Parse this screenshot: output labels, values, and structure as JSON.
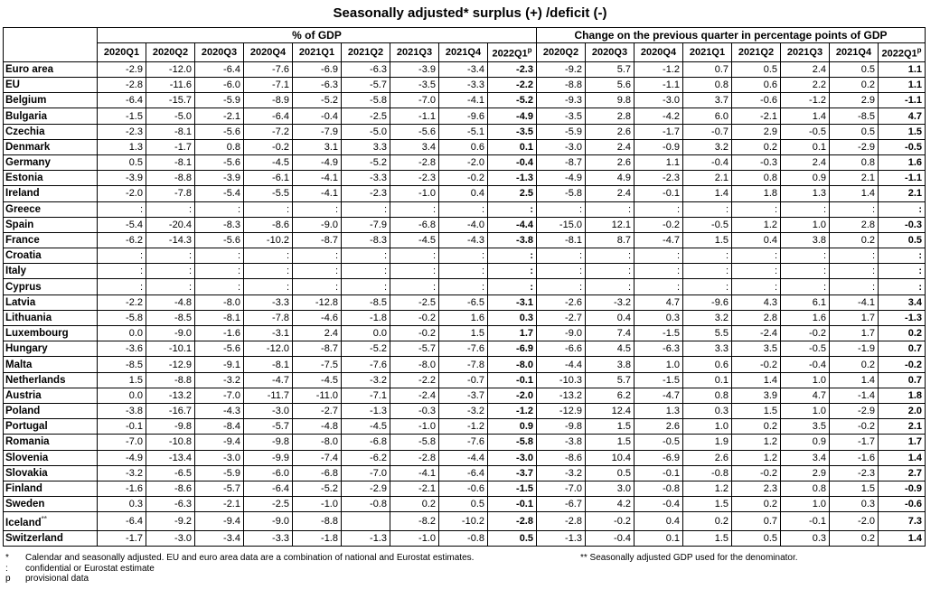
{
  "title": "Seasonally adjusted* surplus (+) /deficit (-)",
  "groups": {
    "left": "% of GDP",
    "right": "Change on the previous quarter in percentage points of GDP"
  },
  "headers_left": [
    "2020Q1",
    "2020Q2",
    "2020Q3",
    "2020Q4",
    "2021Q1",
    "2021Q2",
    "2021Q3",
    "2021Q4",
    "2022Q1"
  ],
  "headers_right": [
    "2020Q2",
    "2020Q3",
    "2020Q4",
    "2021Q1",
    "2021Q2",
    "2021Q3",
    "2021Q4",
    "2022Q1"
  ],
  "provisional_mark": "p",
  "rows": [
    {
      "country": "Euro area",
      "pct": [
        "-2.9",
        "-12.0",
        "-6.4",
        "-7.6",
        "-6.9",
        "-6.3",
        "-3.9",
        "-3.4",
        "-2.3"
      ],
      "chg": [
        "-9.2",
        "5.7",
        "-1.2",
        "0.7",
        "0.5",
        "2.4",
        "0.5",
        "1.1"
      ]
    },
    {
      "country": "EU",
      "pct": [
        "-2.8",
        "-11.6",
        "-6.0",
        "-7.1",
        "-6.3",
        "-5.7",
        "-3.5",
        "-3.3",
        "-2.2"
      ],
      "chg": [
        "-8.8",
        "5.6",
        "-1.1",
        "0.8",
        "0.6",
        "2.2",
        "0.2",
        "1.1"
      ]
    },
    {
      "country": "Belgium",
      "pct": [
        "-6.4",
        "-15.7",
        "-5.9",
        "-8.9",
        "-5.2",
        "-5.8",
        "-7.0",
        "-4.1",
        "-5.2"
      ],
      "chg": [
        "-9.3",
        "9.8",
        "-3.0",
        "3.7",
        "-0.6",
        "-1.2",
        "2.9",
        "-1.1"
      ]
    },
    {
      "country": "Bulgaria",
      "pct": [
        "-1.5",
        "-5.0",
        "-2.1",
        "-6.4",
        "-0.4",
        "-2.5",
        "-1.1",
        "-9.6",
        "-4.9"
      ],
      "chg": [
        "-3.5",
        "2.8",
        "-4.2",
        "6.0",
        "-2.1",
        "1.4",
        "-8.5",
        "4.7"
      ]
    },
    {
      "country": "Czechia",
      "pct": [
        "-2.3",
        "-8.1",
        "-5.6",
        "-7.2",
        "-7.9",
        "-5.0",
        "-5.6",
        "-5.1",
        "-3.5"
      ],
      "chg": [
        "-5.9",
        "2.6",
        "-1.7",
        "-0.7",
        "2.9",
        "-0.5",
        "0.5",
        "1.5"
      ]
    },
    {
      "country": "Denmark",
      "pct": [
        "1.3",
        "-1.7",
        "0.8",
        "-0.2",
        "3.1",
        "3.3",
        "3.4",
        "0.6",
        "0.1"
      ],
      "chg": [
        "-3.0",
        "2.4",
        "-0.9",
        "3.2",
        "0.2",
        "0.1",
        "-2.9",
        "-0.5"
      ]
    },
    {
      "country": "Germany",
      "pct": [
        "0.5",
        "-8.1",
        "-5.6",
        "-4.5",
        "-4.9",
        "-5.2",
        "-2.8",
        "-2.0",
        "-0.4"
      ],
      "chg": [
        "-8.7",
        "2.6",
        "1.1",
        "-0.4",
        "-0.3",
        "2.4",
        "0.8",
        "1.6"
      ]
    },
    {
      "country": "Estonia",
      "pct": [
        "-3.9",
        "-8.8",
        "-3.9",
        "-6.1",
        "-4.1",
        "-3.3",
        "-2.3",
        "-0.2",
        "-1.3"
      ],
      "chg": [
        "-4.9",
        "4.9",
        "-2.3",
        "2.1",
        "0.8",
        "0.9",
        "2.1",
        "-1.1"
      ]
    },
    {
      "country": "Ireland",
      "pct": [
        "-2.0",
        "-7.8",
        "-5.4",
        "-5.5",
        "-4.1",
        "-2.3",
        "-1.0",
        "0.4",
        "2.5"
      ],
      "chg": [
        "-5.8",
        "2.4",
        "-0.1",
        "1.4",
        "1.8",
        "1.3",
        "1.4",
        "2.1"
      ]
    },
    {
      "country": "Greece",
      "pct": [
        ":",
        ":",
        ":",
        ":",
        ":",
        ":",
        ":",
        ":",
        ":"
      ],
      "chg": [
        ":",
        ":",
        ":",
        ":",
        ":",
        ":",
        ":",
        ":"
      ]
    },
    {
      "country": "Spain",
      "pct": [
        "-5.4",
        "-20.4",
        "-8.3",
        "-8.6",
        "-9.0",
        "-7.9",
        "-6.8",
        "-4.0",
        "-4.4"
      ],
      "chg": [
        "-15.0",
        "12.1",
        "-0.2",
        "-0.5",
        "1.2",
        "1.0",
        "2.8",
        "-0.3"
      ]
    },
    {
      "country": "France",
      "pct": [
        "-6.2",
        "-14.3",
        "-5.6",
        "-10.2",
        "-8.7",
        "-8.3",
        "-4.5",
        "-4.3",
        "-3.8"
      ],
      "chg": [
        "-8.1",
        "8.7",
        "-4.7",
        "1.5",
        "0.4",
        "3.8",
        "0.2",
        "0.5"
      ]
    },
    {
      "country": "Croatia",
      "pct": [
        ":",
        ":",
        ":",
        ":",
        ":",
        ":",
        ":",
        ":",
        ":"
      ],
      "chg": [
        ":",
        ":",
        ":",
        ":",
        ":",
        ":",
        ":",
        ":"
      ]
    },
    {
      "country": "Italy",
      "pct": [
        ":",
        ":",
        ":",
        ":",
        ":",
        ":",
        ":",
        ":",
        ":"
      ],
      "chg": [
        ":",
        ":",
        ":",
        ":",
        ":",
        ":",
        ":",
        ":"
      ]
    },
    {
      "country": "Cyprus",
      "pct": [
        ":",
        ":",
        ":",
        ":",
        ":",
        ":",
        ":",
        ":",
        ":"
      ],
      "chg": [
        ":",
        ":",
        ":",
        ":",
        ":",
        ":",
        ":",
        ":"
      ]
    },
    {
      "country": "Latvia",
      "pct": [
        "-2.2",
        "-4.8",
        "-8.0",
        "-3.3",
        "-12.8",
        "-8.5",
        "-2.5",
        "-6.5",
        "-3.1"
      ],
      "chg": [
        "-2.6",
        "-3.2",
        "4.7",
        "-9.6",
        "4.3",
        "6.1",
        "-4.1",
        "3.4"
      ]
    },
    {
      "country": "Lithuania",
      "pct": [
        "-5.8",
        "-8.5",
        "-8.1",
        "-7.8",
        "-4.6",
        "-1.8",
        "-0.2",
        "1.6",
        "0.3"
      ],
      "chg": [
        "-2.7",
        "0.4",
        "0.3",
        "3.2",
        "2.8",
        "1.6",
        "1.7",
        "-1.3"
      ]
    },
    {
      "country": "Luxembourg",
      "pct": [
        "0.0",
        "-9.0",
        "-1.6",
        "-3.1",
        "2.4",
        "0.0",
        "-0.2",
        "1.5",
        "1.7"
      ],
      "chg": [
        "-9.0",
        "7.4",
        "-1.5",
        "5.5",
        "-2.4",
        "-0.2",
        "1.7",
        "0.2"
      ]
    },
    {
      "country": "Hungary",
      "pct": [
        "-3.6",
        "-10.1",
        "-5.6",
        "-12.0",
        "-8.7",
        "-5.2",
        "-5.7",
        "-7.6",
        "-6.9"
      ],
      "chg": [
        "-6.6",
        "4.5",
        "-6.3",
        "3.3",
        "3.5",
        "-0.5",
        "-1.9",
        "0.7"
      ]
    },
    {
      "country": "Malta",
      "pct": [
        "-8.5",
        "-12.9",
        "-9.1",
        "-8.1",
        "-7.5",
        "-7.6",
        "-8.0",
        "-7.8",
        "-8.0"
      ],
      "chg": [
        "-4.4",
        "3.8",
        "1.0",
        "0.6",
        "-0.2",
        "-0.4",
        "0.2",
        "-0.2"
      ]
    },
    {
      "country": "Netherlands",
      "pct": [
        "1.5",
        "-8.8",
        "-3.2",
        "-4.7",
        "-4.5",
        "-3.2",
        "-2.2",
        "-0.7",
        "-0.1"
      ],
      "chg": [
        "-10.3",
        "5.7",
        "-1.5",
        "0.1",
        "1.4",
        "1.0",
        "1.4",
        "0.7"
      ]
    },
    {
      "country": "Austria",
      "pct": [
        "0.0",
        "-13.2",
        "-7.0",
        "-11.7",
        "-11.0",
        "-7.1",
        "-2.4",
        "-3.7",
        "-2.0"
      ],
      "chg": [
        "-13.2",
        "6.2",
        "-4.7",
        "0.8",
        "3.9",
        "4.7",
        "-1.4",
        "1.8"
      ]
    },
    {
      "country": "Poland",
      "pct": [
        "-3.8",
        "-16.7",
        "-4.3",
        "-3.0",
        "-2.7",
        "-1.3",
        "-0.3",
        "-3.2",
        "-1.2"
      ],
      "chg": [
        "-12.9",
        "12.4",
        "1.3",
        "0.3",
        "1.5",
        "1.0",
        "-2.9",
        "2.0"
      ]
    },
    {
      "country": "Portugal",
      "pct": [
        "-0.1",
        "-9.8",
        "-8.4",
        "-5.7",
        "-4.8",
        "-4.5",
        "-1.0",
        "-1.2",
        "0.9"
      ],
      "chg": [
        "-9.8",
        "1.5",
        "2.6",
        "1.0",
        "0.2",
        "3.5",
        "-0.2",
        "2.1"
      ]
    },
    {
      "country": "Romania",
      "pct": [
        "-7.0",
        "-10.8",
        "-9.4",
        "-9.8",
        "-8.0",
        "-6.8",
        "-5.8",
        "-7.6",
        "-5.8"
      ],
      "chg": [
        "-3.8",
        "1.5",
        "-0.5",
        "1.9",
        "1.2",
        "0.9",
        "-1.7",
        "1.7"
      ]
    },
    {
      "country": "Slovenia",
      "pct": [
        "-4.9",
        "-13.4",
        "-3.0",
        "-9.9",
        "-7.4",
        "-6.2",
        "-2.8",
        "-4.4",
        "-3.0"
      ],
      "chg": [
        "-8.6",
        "10.4",
        "-6.9",
        "2.6",
        "1.2",
        "3.4",
        "-1.6",
        "1.4"
      ]
    },
    {
      "country": "Slovakia",
      "pct": [
        "-3.2",
        "-6.5",
        "-5.9",
        "-6.0",
        "-6.8",
        "-7.0",
        "-4.1",
        "-6.4",
        "-3.7"
      ],
      "chg": [
        "-3.2",
        "0.5",
        "-0.1",
        "-0.8",
        "-0.2",
        "2.9",
        "-2.3",
        "2.7"
      ]
    },
    {
      "country": "Finland",
      "pct": [
        "-1.6",
        "-8.6",
        "-5.7",
        "-6.4",
        "-5.2",
        "-2.9",
        "-2.1",
        "-0.6",
        "-1.5"
      ],
      "chg": [
        "-7.0",
        "3.0",
        "-0.8",
        "1.2",
        "2.3",
        "0.8",
        "1.5",
        "-0.9"
      ]
    },
    {
      "country": "Sweden",
      "pct": [
        "0.3",
        "-6.3",
        "-2.1",
        "-2.5",
        "-1.0",
        "-0.8",
        "0.2",
        "0.5",
        "-0.1"
      ],
      "chg": [
        "-6.7",
        "4.2",
        "-0.4",
        "1.5",
        "0.2",
        "1.0",
        "0.3",
        "-0.6"
      ]
    },
    {
      "country": "Iceland",
      "suffix": "**",
      "pct": [
        "-6.4",
        "-9.2",
        "-9.4",
        "-9.0",
        "-8.8",
        "",
        "-8.2",
        "-10.2",
        "-2.8"
      ],
      "chg": [
        "-2.8",
        "-0.2",
        "0.4",
        "0.2",
        "0.7",
        "-0.1",
        "-2.0",
        "7.3"
      ]
    },
    {
      "country": "Switzerland",
      "pct": [
        "-1.7",
        "-3.0",
        "-3.4",
        "-3.3",
        "-1.8",
        "-1.3",
        "-1.0",
        "-0.8",
        "0.5"
      ],
      "chg": [
        "-1.3",
        "-0.4",
        "0.1",
        "1.5",
        "0.5",
        "0.3",
        "0.2",
        "1.4"
      ]
    }
  ],
  "notes": [
    {
      "sym": "*",
      "text": "Calendar and seasonally adjusted. EU and euro area data are a combination of national and Eurostat estimates."
    },
    {
      "sym": ":",
      "text": "confidential or Eurostat estimate"
    },
    {
      "sym": "p",
      "text": "provisional data"
    }
  ],
  "note_right": "** Seasonally adjusted GDP used for the denominator."
}
